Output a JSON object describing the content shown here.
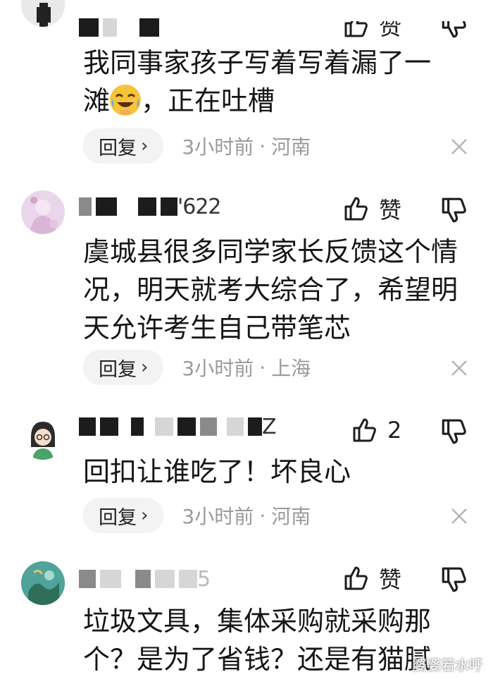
{
  "comments": [
    {
      "text_line1": "我同事家孩子写着写着漏了一",
      "text_line2_pre": "滩",
      "text_line2_post": "，正在吐槽",
      "emoji": "laughing-crying-emoji",
      "reply_label": "回复",
      "time": "3小时前",
      "location": "河南",
      "like_label": "赞"
    },
    {
      "text": "虞城县很多同学家长反馈这个情况，明天就考大综合了，希望明天允许考生自己带笔芯",
      "reply_label": "回复",
      "time": "3小时前",
      "location": "上海",
      "like_label": "赞",
      "name_tail": "'622"
    },
    {
      "text": "回扣让谁吃了！坏良心",
      "reply_label": "回复",
      "time": "3小时前",
      "location": "河南",
      "like_count": "2",
      "name_tail": "Z"
    },
    {
      "text": "垃圾文具，集体采购就采购那个？是为了省钱？还是有猫腻",
      "like_label": "赞",
      "name_tail": "5"
    }
  ],
  "meta_separator": "·",
  "reply_chevron": "›",
  "watermark": "婆婆若水吁",
  "icons": {
    "like": "thumbs-up-icon",
    "dislike": "thumbs-down-icon",
    "close": "close-icon"
  },
  "colors": {
    "text": "#161616",
    "meta": "#9a9a9a",
    "reply_bg": "#f3f3f3"
  }
}
